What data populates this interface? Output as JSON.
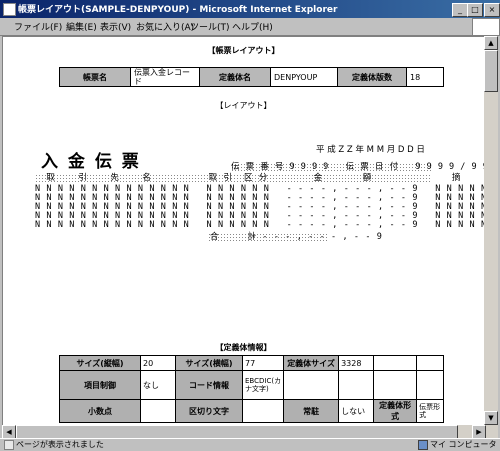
{
  "window": {
    "title": "帳票レイアウト(SAMPLE-DENPYOUP) - Microsoft Internet Explorer"
  },
  "menu": [
    "ファイル(F)",
    "編集(E)",
    "表示(V)",
    "お気に入り(A)",
    "ツール(T)",
    "ヘルプ(H)"
  ],
  "page": {
    "section1_title": "【帳票レイアウト】",
    "header": {
      "name_label": "帳票名",
      "name_value": "伝票入金レコード",
      "def_label": "定義体名",
      "def_value": "DENPYOUP",
      "count_label": "定義体版数",
      "count_value": "18"
    },
    "layout_title": "【レイアウト】",
    "form": {
      "title": "入 金 伝 票",
      "date": "平 成 Z Z 年 M M 月 D D 日",
      "slip_header": "伝 票 番 号 9 9 9 9   伝 票 日 付   9 9 9 9 / 9 9 / 9 9",
      "col_header": "  取    引    先    名          取 引  区 分        金       額              摘     要",
      "rows": [
        "N N N N N N N N N N N N N N   N N N N N N   - - - - , - - - , - - 9   N N N N N N N N",
        "N N N N N N N N N N N N N N   N N N N N N   - - - - , - - - , - - 9   N N N N N N N N",
        "N N N N N N N N N N N N N N   N N N N N N   - - - - , - - - , - - 9   N N N N N N N N",
        "N N N N N N N N N N N N N N   N N N N N N   - - - - , - - - , - - 9   N N N N N N N N",
        "N N N N N N N N N N N N N N   N N N N N N   - - - - , - - - , - - 9   N N N N N N N N"
      ],
      "total_label": "合     計",
      "total_value": "- - - - , - - - , - - 9"
    },
    "spec_title": "【定義体情報】",
    "spec": {
      "size_v_label": "サイズ(縦幅)",
      "size_v": "20",
      "size_h_label": "サイズ(横幅)",
      "size_h": "77",
      "def_size_label": "定義体サイズ",
      "def_size": "3328",
      "item_ctrl_label": "項目制御",
      "item_ctrl": "なし",
      "code_label": "コード情報",
      "code": "EBCDIC(カナ文字)",
      "decimal_label": "小数点",
      "sep_label": "区切り文字",
      "resident_label": "常駐",
      "resident": "しない",
      "format_label": "定義体形式",
      "format": "伝票形式"
    }
  },
  "status": {
    "text": "ページが表示されました",
    "zone": "マイ コンピュータ"
  }
}
